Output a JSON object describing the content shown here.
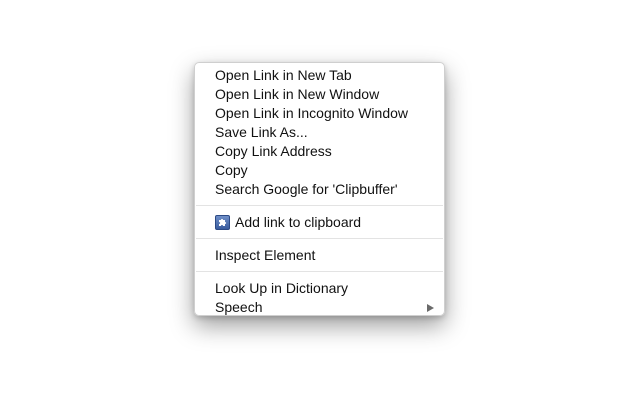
{
  "context_menu": {
    "group1": [
      {
        "label": "Open Link in New Tab"
      },
      {
        "label": "Open Link in New Window"
      },
      {
        "label": "Open Link in Incognito Window"
      },
      {
        "label": "Save Link As..."
      },
      {
        "label": "Copy Link Address"
      },
      {
        "label": "Copy"
      },
      {
        "label": "Search Google for 'Clipbuffer'"
      }
    ],
    "extension_item": {
      "label": "Add link to clipboard",
      "icon": "puzzle-piece-icon"
    },
    "inspect_item": {
      "label": "Inspect Element"
    },
    "group4": [
      {
        "label": "Look Up in Dictionary"
      },
      {
        "label": "Speech",
        "submenu_icon": "submenu-arrow-icon"
      }
    ]
  }
}
